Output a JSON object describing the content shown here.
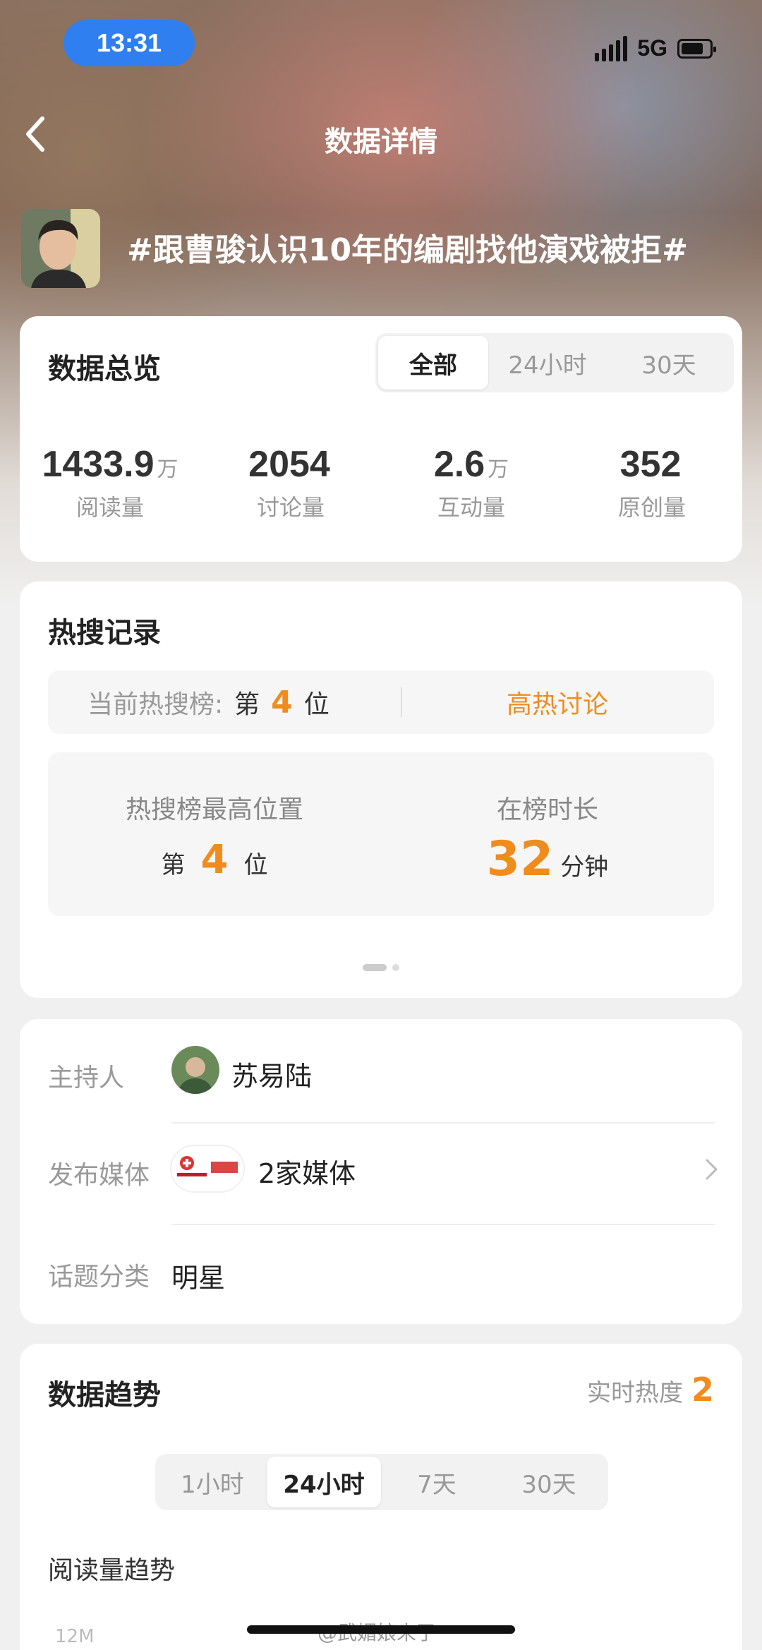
{
  "status_bar": {
    "time": "13:31",
    "network": "5G"
  },
  "header": {
    "title": "数据详情"
  },
  "topic": {
    "title": "#跟曹骏认识10年的编剧找他演戏被拒#"
  },
  "overview": {
    "title": "数据总览",
    "tabs": [
      "全部",
      "24小时",
      "30天"
    ],
    "active_tab": "全部",
    "stats": [
      {
        "value": "1433.9",
        "unit": "万",
        "label": "阅读量"
      },
      {
        "value": "2054",
        "unit": "",
        "label": "讨论量"
      },
      {
        "value": "2.6",
        "unit": "万",
        "label": "互动量"
      },
      {
        "value": "352",
        "unit": "",
        "label": "原创量"
      }
    ]
  },
  "hot_search": {
    "title": "热搜记录",
    "current_label": "当前热搜榜:",
    "current_prefix": "第",
    "current_rank": "4",
    "current_suffix": "位",
    "badge": "高热讨论",
    "highest_label": "热搜榜最高位置",
    "highest_prefix": "第",
    "highest_rank": "4",
    "highest_suffix": "位",
    "duration_label": "在榜时长",
    "duration_value": "32",
    "duration_unit": "分钟"
  },
  "info": {
    "host_label": "主持人",
    "host_name": "苏易陆",
    "media_label": "发布媒体",
    "media_value": "2家媒体",
    "category_label": "话题分类",
    "category_value": "明星"
  },
  "trend": {
    "title": "数据趋势",
    "realtime_label": "实时热度",
    "realtime_value": "2",
    "tabs": [
      "1小时",
      "24小时",
      "7天",
      "30天"
    ],
    "active_tab": "24小时",
    "subtitle": "阅读量趋势",
    "axis_tick": "12M"
  },
  "watermark": "@武媚娘来了",
  "colors": {
    "accent": "#f08c1e",
    "time_pill": "#2f7ff0"
  }
}
